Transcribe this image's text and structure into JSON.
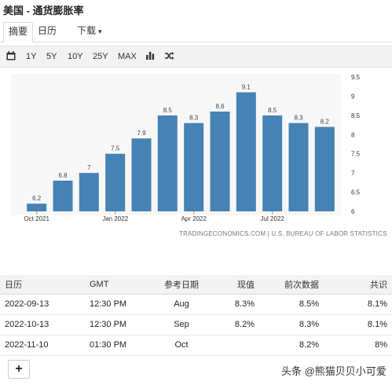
{
  "title": "美国 - 通货膨胀率",
  "tabs": [
    {
      "label": "摘要"
    },
    {
      "label": "日历"
    },
    {
      "label": "下载"
    }
  ],
  "toolbar": {
    "items": [
      "1Y",
      "5Y",
      "10Y",
      "25Y",
      "MAX"
    ],
    "icons": [
      "calendar-icon",
      "bar-chart-icon",
      "shuffle-icon"
    ]
  },
  "chart_data": {
    "type": "bar",
    "categories": [
      "2021-10",
      "2021-11",
      "2021-12",
      "2022-01",
      "2022-02",
      "2022-03",
      "2022-04",
      "2022-05",
      "2022-06",
      "2022-07",
      "2022-08",
      "2022-09"
    ],
    "values": [
      6.2,
      6.8,
      7,
      7.5,
      7.9,
      8.5,
      8.3,
      8.6,
      9.1,
      8.5,
      8.3,
      8.2
    ],
    "data_labels": [
      "6.2",
      "6.8",
      "7",
      "7.5",
      "7.9",
      "8.5",
      "8.3",
      "8.6",
      "9.1",
      "8.5",
      "8.3",
      "8.2"
    ],
    "x_tick_labels": [
      {
        "category": "2021-10",
        "text": "Oct 2021"
      },
      {
        "category": "2022-01",
        "text": "Jan 2022"
      },
      {
        "category": "2022-04",
        "text": "Apr 2022"
      },
      {
        "category": "2022-07",
        "text": "Jul 2022"
      }
    ],
    "y_ticks": [
      "6",
      "6.5",
      "7",
      "7.5",
      "8",
      "8.5",
      "9",
      "9.5"
    ],
    "ylim": [
      6,
      9.5
    ],
    "bar_color": "#4682b4",
    "grid": false,
    "source": "TRADINGECONOMICS.COM  |  U.S. BUREAU OF LABOR STATISTICS"
  },
  "table": {
    "headers": [
      "日历",
      "GMT",
      "参考日期",
      "现值",
      "前次数据",
      "共识"
    ],
    "rows": [
      [
        "2022-09-13",
        "12:30 PM",
        "Aug",
        "8.3%",
        "8.5%",
        "8.1%"
      ],
      [
        "2022-10-13",
        "12:30 PM",
        "Sep",
        "8.2%",
        "8.3%",
        "8.1%"
      ],
      [
        "2022-11-10",
        "01:30 PM",
        "Oct",
        "",
        "8.2%",
        "8%"
      ]
    ]
  },
  "add_button": "+",
  "watermark": "头条 @熊猫贝贝小可爱"
}
